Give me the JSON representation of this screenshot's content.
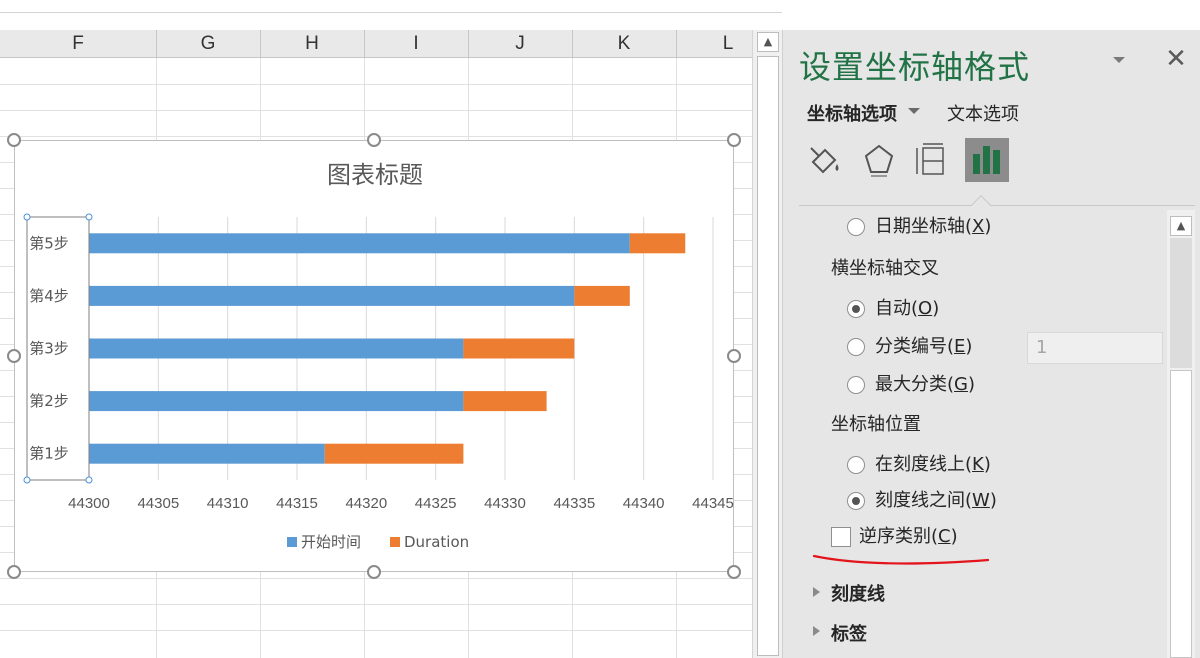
{
  "sheet": {
    "columns": [
      "F",
      "G",
      "H",
      "I",
      "J",
      "K",
      "L"
    ]
  },
  "chart_data": {
    "type": "bar",
    "orientation": "horizontal",
    "stacked": true,
    "title": "图表标题",
    "categories": [
      "第1步",
      "第2步",
      "第3步",
      "第4步",
      "第5步"
    ],
    "series": [
      {
        "name": "开始时间",
        "color": "#5b9bd5",
        "values": [
          44317,
          44327,
          44327,
          44335,
          44339
        ]
      },
      {
        "name": "Duration",
        "color": "#ed7d31",
        "values": [
          10,
          6,
          8,
          4,
          4
        ]
      }
    ],
    "x_ticks": [
      "44300",
      "44305",
      "44310",
      "44315",
      "44320",
      "44325",
      "44330",
      "44335",
      "44340",
      "44345"
    ],
    "xlim": [
      44300,
      44345
    ],
    "grid": true,
    "legend_position": "bottom"
  },
  "pane": {
    "title": "设置坐标轴格式",
    "tab_axis_options": "坐标轴选项",
    "tab_text_options": "文本选项",
    "icons": [
      "fill-line-icon",
      "effects-icon",
      "size-properties-icon",
      "axis-options-bar-icon"
    ],
    "options": {
      "date_axis": "日期坐标轴(X)",
      "date_axis_text": "日期坐标轴(",
      "date_axis_key": "X",
      "cross_label": "横坐标轴交叉",
      "auto_text": "自动(",
      "auto_key": "O",
      "cat_number_text": "分类编号(",
      "cat_number_key": "E",
      "cat_number_value": "1",
      "max_cat_text": "最大分类(",
      "max_cat_key": "G",
      "position_label": "坐标轴位置",
      "on_tick_text": "在刻度线上(",
      "on_tick_key": "K",
      "between_text": "刻度线之间(",
      "between_key": "W",
      "reverse_text": "逆序类别(",
      "reverse_key": "C",
      "tick_marks": "刻度线",
      "labels": "标签"
    },
    "selected": {
      "cross": "auto",
      "position": "between",
      "reverse_categories": false
    }
  }
}
